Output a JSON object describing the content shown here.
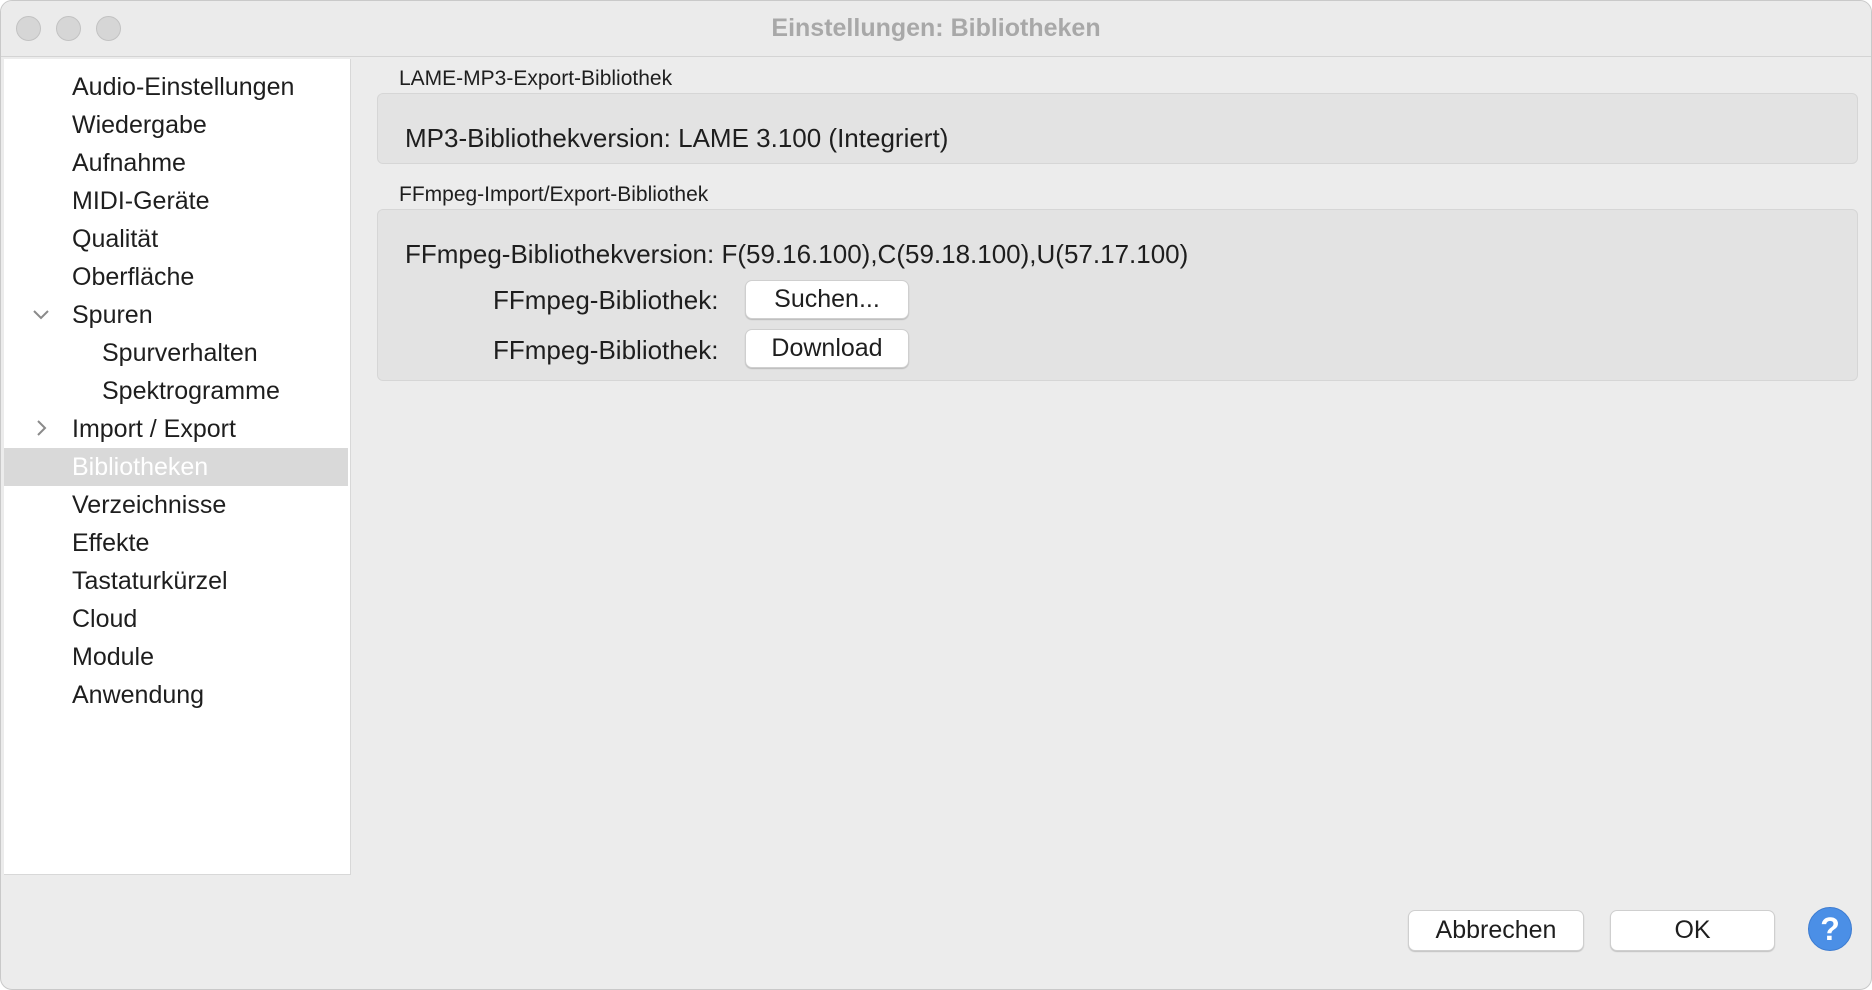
{
  "window": {
    "title": "Einstellungen: Bibliotheken"
  },
  "sidebar": {
    "items": [
      {
        "label": "Audio-Einstellungen"
      },
      {
        "label": "Wiedergabe"
      },
      {
        "label": "Aufnahme"
      },
      {
        "label": "MIDI-Geräte"
      },
      {
        "label": "Qualität"
      },
      {
        "label": "Oberfläche"
      },
      {
        "label": "Spuren",
        "expanded": true
      },
      {
        "label": "Spurverhalten"
      },
      {
        "label": "Spektrogramme"
      },
      {
        "label": "Import / Export",
        "expanded": false
      },
      {
        "label": "Bibliotheken",
        "selected": true
      },
      {
        "label": "Verzeichnisse"
      },
      {
        "label": "Effekte"
      },
      {
        "label": "Tastaturkürzel"
      },
      {
        "label": "Cloud"
      },
      {
        "label": "Module"
      },
      {
        "label": "Anwendung"
      }
    ]
  },
  "lame": {
    "group_label": "LAME-MP3-Export-Bibliothek",
    "version_text": "MP3-Bibliothekversion: LAME 3.100 (Integriert)"
  },
  "ffmpeg": {
    "group_label": "FFmpeg-Import/Export-Bibliothek",
    "version_text": "FFmpeg-Bibliothekversion: F(59.16.100),C(59.18.100),U(57.17.100)",
    "locate_label": "FFmpeg-Bibliothek:",
    "locate_button": "Suchen...",
    "download_label": "FFmpeg-Bibliothek:",
    "download_button": "Download"
  },
  "footer": {
    "cancel_button": "Abbrechen",
    "ok_button": "OK",
    "help_icon": "?"
  },
  "colors": {
    "selection": "#d9d9d9",
    "help_accent": "#4b8fe6"
  }
}
